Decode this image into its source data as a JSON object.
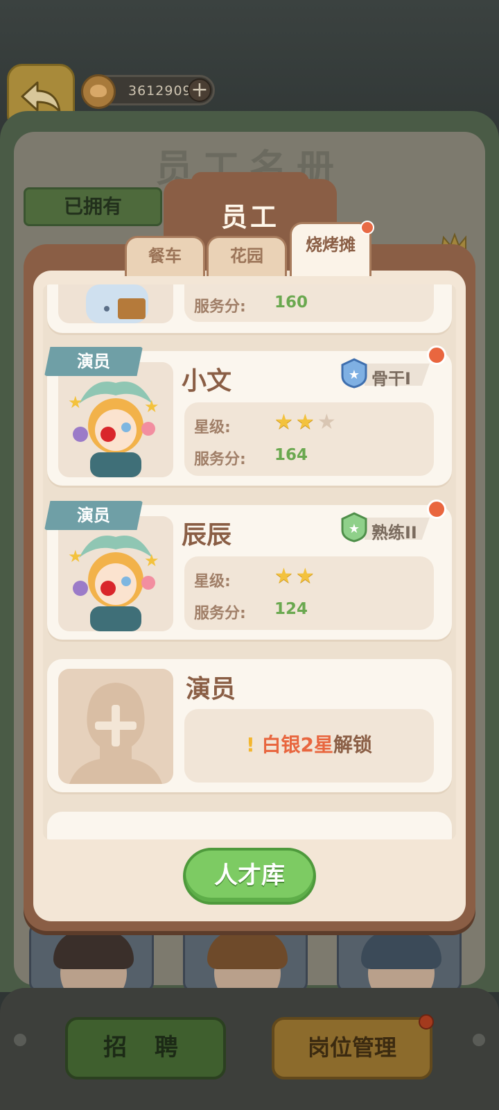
{
  "currency": {
    "amount": "3612909"
  },
  "roster": {
    "title": "员工名册",
    "owned_tab": "已拥有"
  },
  "panel": {
    "title": "员工",
    "tabs": [
      {
        "label": "餐车"
      },
      {
        "label": "花园"
      },
      {
        "label": "烧烤摊",
        "active": true,
        "has_notification": true
      }
    ]
  },
  "labels": {
    "star_label": "星级:",
    "service_label": "服务分:"
  },
  "employees": [
    {
      "service_score": "160"
    },
    {
      "role": "演员",
      "name": "小文",
      "rank": "骨干I",
      "stars": 2,
      "max_stars": 3,
      "service_score": "164",
      "has_notification": true
    },
    {
      "role": "演员",
      "name": "辰辰",
      "rank": "熟练II",
      "stars": 2,
      "max_stars": 2,
      "service_score": "124",
      "has_notification": true
    }
  ],
  "locked_slot": {
    "role": "演员",
    "unlock_highlight": "白银2星",
    "unlock_suffix": "解锁"
  },
  "buttons": {
    "talent_pool": "人才库",
    "recruit": "招 聘",
    "post_management": "岗位管理"
  },
  "colors": {
    "accent_green": "#6aa84f",
    "panel_brown": "#8a5e45",
    "notify_red": "#e9663f",
    "star_gold": "#f3c23d"
  }
}
